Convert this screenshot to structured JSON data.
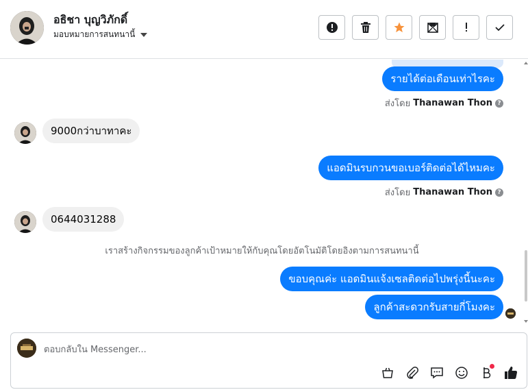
{
  "header": {
    "contact_name": "อธิชา บุญวิภักดิ์",
    "assign_label": "มอบหมายการสนทนานี้",
    "actions": [
      {
        "name": "spam-button",
        "icon": "alert-circle-icon"
      },
      {
        "name": "delete-button",
        "icon": "trash-icon"
      },
      {
        "name": "star-button",
        "icon": "star-icon",
        "color": "#f7923b"
      },
      {
        "name": "mark-unread-button",
        "icon": "envelope-icon"
      },
      {
        "name": "follow-up-button",
        "icon": "exclamation-icon"
      },
      {
        "name": "done-button",
        "icon": "check-icon"
      }
    ]
  },
  "thread": {
    "messages": [
      {
        "direction": "out",
        "text": "รายได้ต่อเดือนเท่าไรคะ"
      },
      {
        "direction": "in",
        "text": "9000กว่าบาทาคะ"
      },
      {
        "direction": "out",
        "text": "แอดมินรบกวนขอเบอร์ติดต่อได้ไหมคะ"
      },
      {
        "direction": "in",
        "text": "0644031288"
      },
      {
        "direction": "out",
        "text": "ขอบคุณค่ะ แอดมินแจ้งเซลติดต่อไปพรุ่งนี้นะคะ"
      },
      {
        "direction": "out",
        "text": "ลูกค้าสะดวกรับสายกี่โมงคะ"
      }
    ],
    "sent_by_prefix": "ส่งโดย",
    "sent_by_name": "Thanawan Thon",
    "system_note": "เราสร้างกิจกรรมของลูกค้าเป้าหมายให้กับคุณโดยอัตโนมัติโดยอิงตามการสนทนานี้"
  },
  "composer": {
    "placeholder": "ตอบกลับใน Messenger...",
    "tools": [
      "shop-bag-icon",
      "paperclip-icon",
      "chat-bubble-icon",
      "emoji-icon",
      "baht-icon",
      "thumbs-up-icon"
    ]
  },
  "colors": {
    "outgoing_bubble": "#0a7cff",
    "incoming_bubble": "#f0f0f0",
    "star": "#f7923b",
    "notification_dot": "#f02849"
  }
}
